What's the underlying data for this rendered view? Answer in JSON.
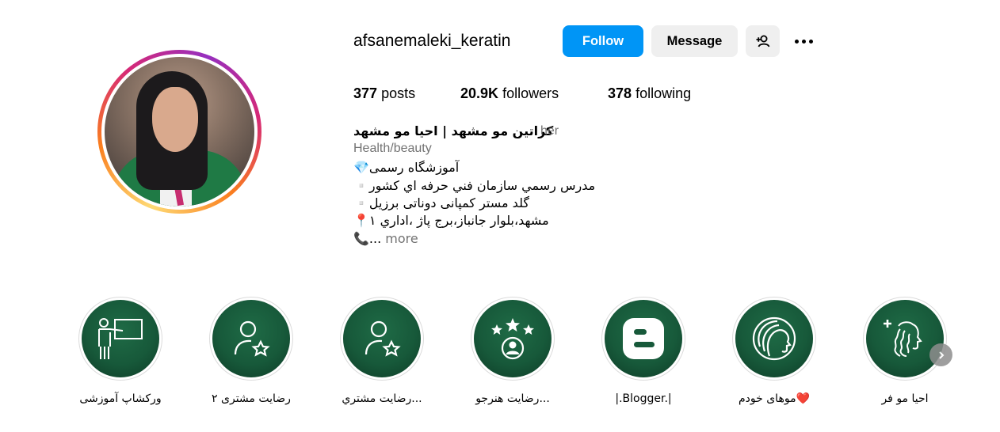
{
  "profile": {
    "username": "afsanemaleki_keratin",
    "follow_label": "Follow",
    "message_label": "Message",
    "add_user_icon": "person-add-icon",
    "more_icon": "more-options-icon",
    "accent_color": "#0095f6"
  },
  "stats": {
    "posts_count": "377",
    "posts_label": "posts",
    "followers_count": "20.9K",
    "followers_label": "followers",
    "following_count": "378",
    "following_label": "following"
  },
  "bio": {
    "name": "کراتین مو مشهد | احیا مو مشهد",
    "pronouns": "her",
    "category": "Health/beauty",
    "lines": [
      "آموزشگاه رسمی💎",
      "مدرس رسمي سازمان فني حرفه اي كشور▫️",
      "گلد مستر کمپانی دوناتی برزیل▫️",
      "مشهد،بلوار جانباز،برج پاژ ،اداري ١📍",
      "📞..."
    ],
    "more_label": "more"
  },
  "highlights": [
    {
      "label": "ورکشاپ آموزشی",
      "icon": "teacher-board-icon"
    },
    {
      "label": "رضایت مشتری ۲",
      "icon": "user-star-icon"
    },
    {
      "label": "رضایت مشتري...",
      "icon": "user-star-icon"
    },
    {
      "label": "رضایت هنرجو...",
      "icon": "stars-user-icon"
    },
    {
      "label": "|.Blogger.|",
      "icon": "blogger-icon"
    },
    {
      "label": "موهای خودم❤️",
      "icon": "woman-hair-icon"
    },
    {
      "label": "احیا مو فر",
      "icon": "curly-hair-plus-icon"
    }
  ],
  "next_icon": "chevron-right-icon"
}
